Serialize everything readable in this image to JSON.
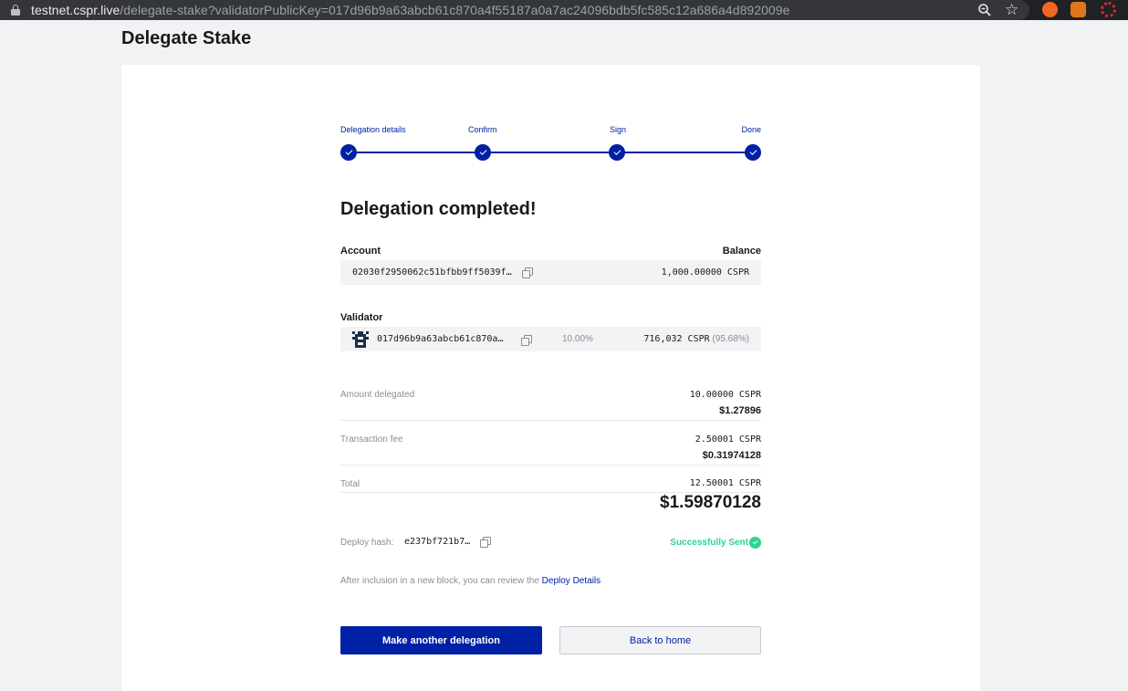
{
  "browser": {
    "url_host": "testnet.cspr.live",
    "url_path": "/delegate-stake?validatorPublicKey=017d96b9a63abcb61c870a4f55187a0a7ac24096bdb5fc585c12a686a4d892009e",
    "icons": [
      "lock-icon",
      "zoom-icon",
      "star-icon",
      "extension-icon",
      "metamask-icon",
      "casper-signer-icon"
    ]
  },
  "page_title": "Delegate Stake",
  "stepper": {
    "steps": [
      {
        "label": "Delegation details",
        "done": true
      },
      {
        "label": "Confirm",
        "done": true
      },
      {
        "label": "Sign",
        "done": true
      },
      {
        "label": "Done",
        "done": true
      }
    ]
  },
  "heading": "Delegation completed!",
  "account": {
    "label": "Account",
    "balance_label": "Balance",
    "key": "02030f2950062c51bfbb9ff5039f…",
    "balance": "1,000.00000 CSPR"
  },
  "validator": {
    "label": "Validator",
    "key": "017d96b9a63abcb61c870a…",
    "fee": "10.00%",
    "stake": "716,032 CSPR",
    "stake_pct": "(95.68%)"
  },
  "summary": {
    "amount_label": "Amount delegated",
    "amount_cspr": "10.00000 CSPR",
    "amount_usd": "$1.27896",
    "fee_label": "Transaction fee",
    "fee_cspr": "2.50001 CSPR",
    "fee_usd": "$0.31974128",
    "total_label": "Total",
    "total_cspr": "12.50001 CSPR",
    "total_usd": "$1.59870128"
  },
  "deploy": {
    "hash_label": "Deploy hash:",
    "hash": "e237bf721b7…",
    "status": "Successfully Sent",
    "status_color": "#2bd48c",
    "note_prefix": "After inclusion in a new block, you can review the",
    "note_link": "Deploy Details"
  },
  "buttons": {
    "primary": "Make another delegation",
    "secondary": "Back to home"
  },
  "colors": {
    "accent": "#0021a5",
    "page_bg": "#f1f2f4"
  }
}
